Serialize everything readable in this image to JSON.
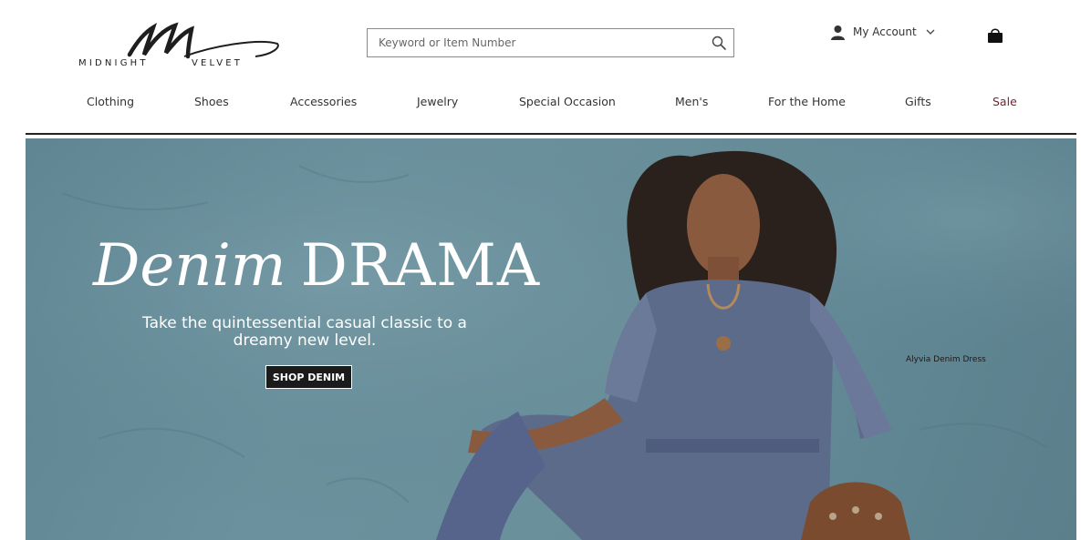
{
  "brand": {
    "logo_text": "MIDNIGHT VELVET"
  },
  "header": {
    "search_placeholder": "Keyword or Item Number",
    "search_icon": "search-icon",
    "account_label": "My Account",
    "account_icon": "user-icon",
    "account_chevron_icon": "chevron-down-icon",
    "cart_icon": "shopping-bag-icon"
  },
  "nav": {
    "items": [
      {
        "label": "Clothing"
      },
      {
        "label": "Shoes"
      },
      {
        "label": "Accessories"
      },
      {
        "label": "Jewelry"
      },
      {
        "label": "Special Occasion"
      },
      {
        "label": "Men's"
      },
      {
        "label": "For the Home"
      },
      {
        "label": "Gifts"
      },
      {
        "label": "Sale"
      }
    ],
    "sale_color": "#7a1f2b"
  },
  "hero": {
    "headline_script": "Denim",
    "headline_caps": "DRAMA",
    "subtitle": "Take the quintessential casual classic to a dreamy new level.",
    "cta_label": "SHOP DENIM",
    "product_caption": "Alyvia Denim Dress",
    "background_color": "#678d9a"
  }
}
